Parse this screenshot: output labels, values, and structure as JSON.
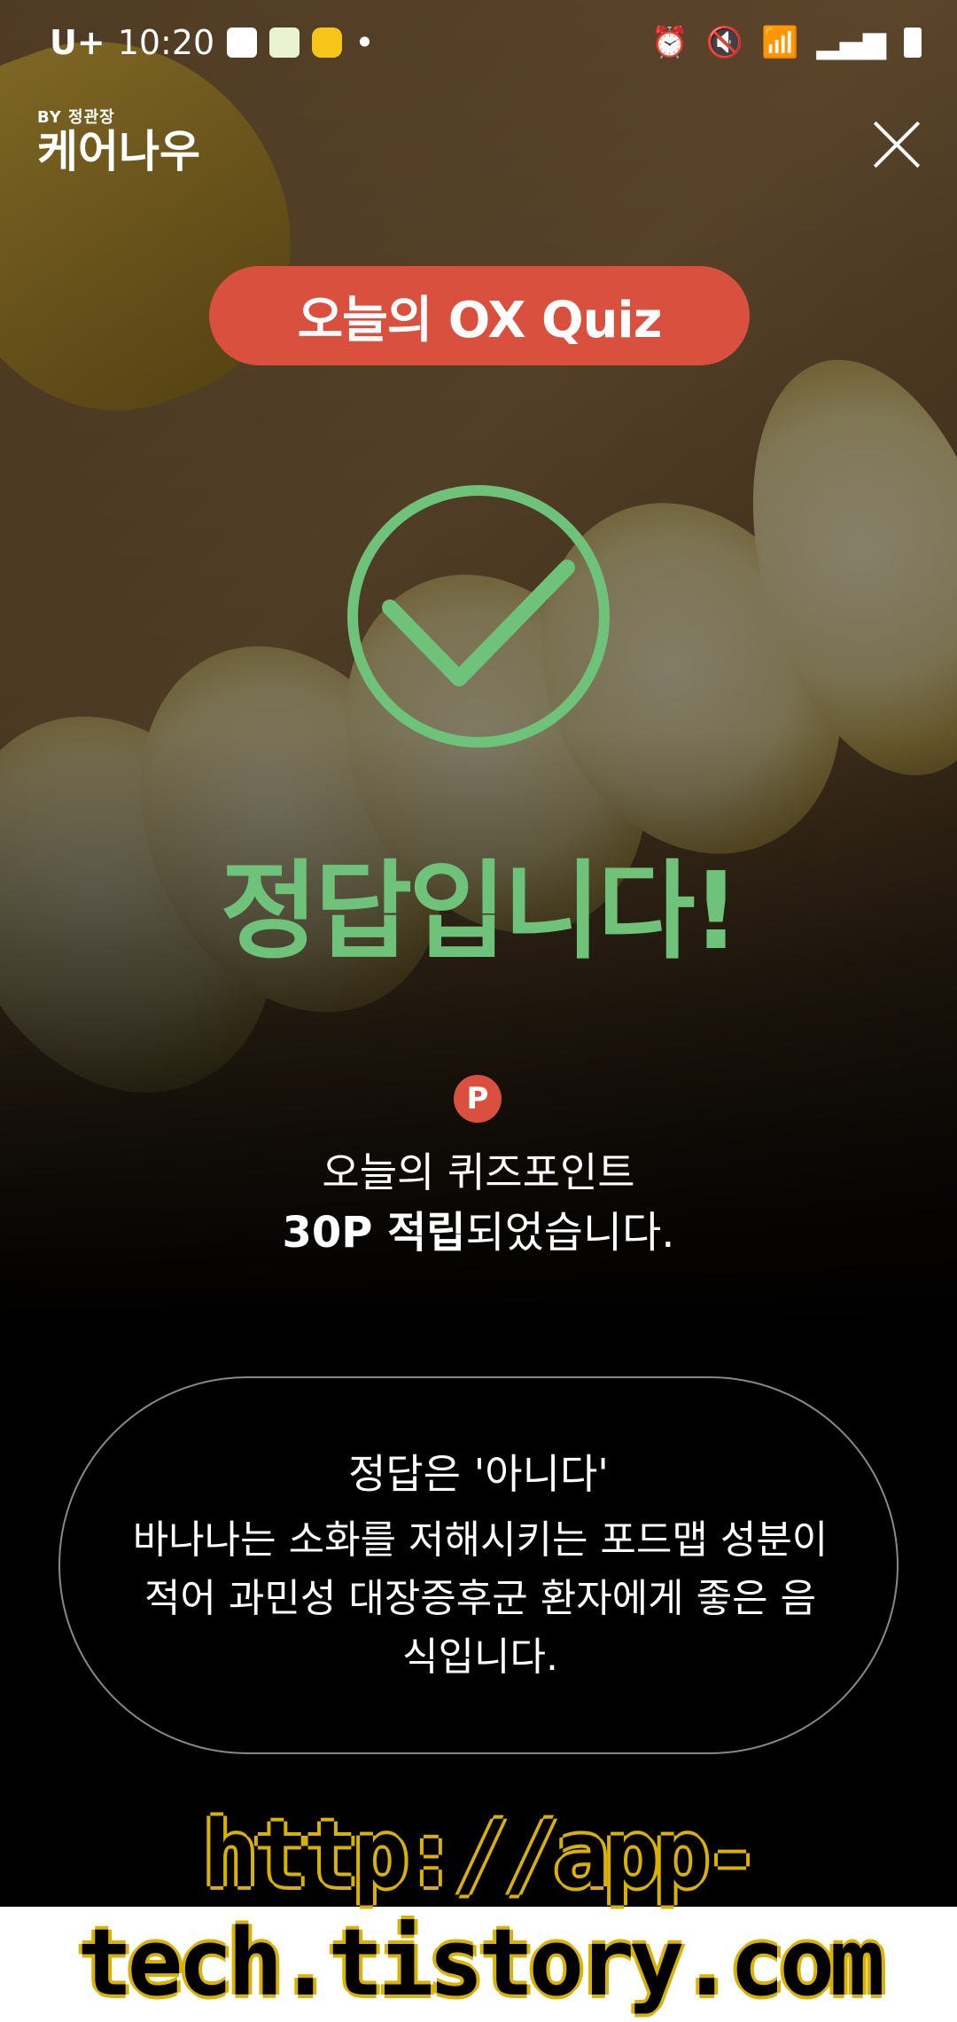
{
  "status": {
    "carrier": "U+",
    "time": "10:20",
    "dot": "•"
  },
  "logo": {
    "sub": "BY 정관장",
    "main": "케어나우"
  },
  "quiz": {
    "title": "오늘의 OX Quiz"
  },
  "result": {
    "text": "정답입니다!",
    "color": "#6fc27a"
  },
  "points": {
    "badge": "P",
    "line1": "오늘의 퀴즈포인트",
    "line2_bold": "30P 적립",
    "line2_rest": "되었습니다."
  },
  "answer": {
    "title": "정답은 '아니다'",
    "body": "바나나는 소화를 저해시키는 포드맵 성분이 적어 과민성 대장증후군 환자에게 좋은 음식입니다."
  },
  "watermark": {
    "text": "http://app-tech.tistory.com"
  }
}
